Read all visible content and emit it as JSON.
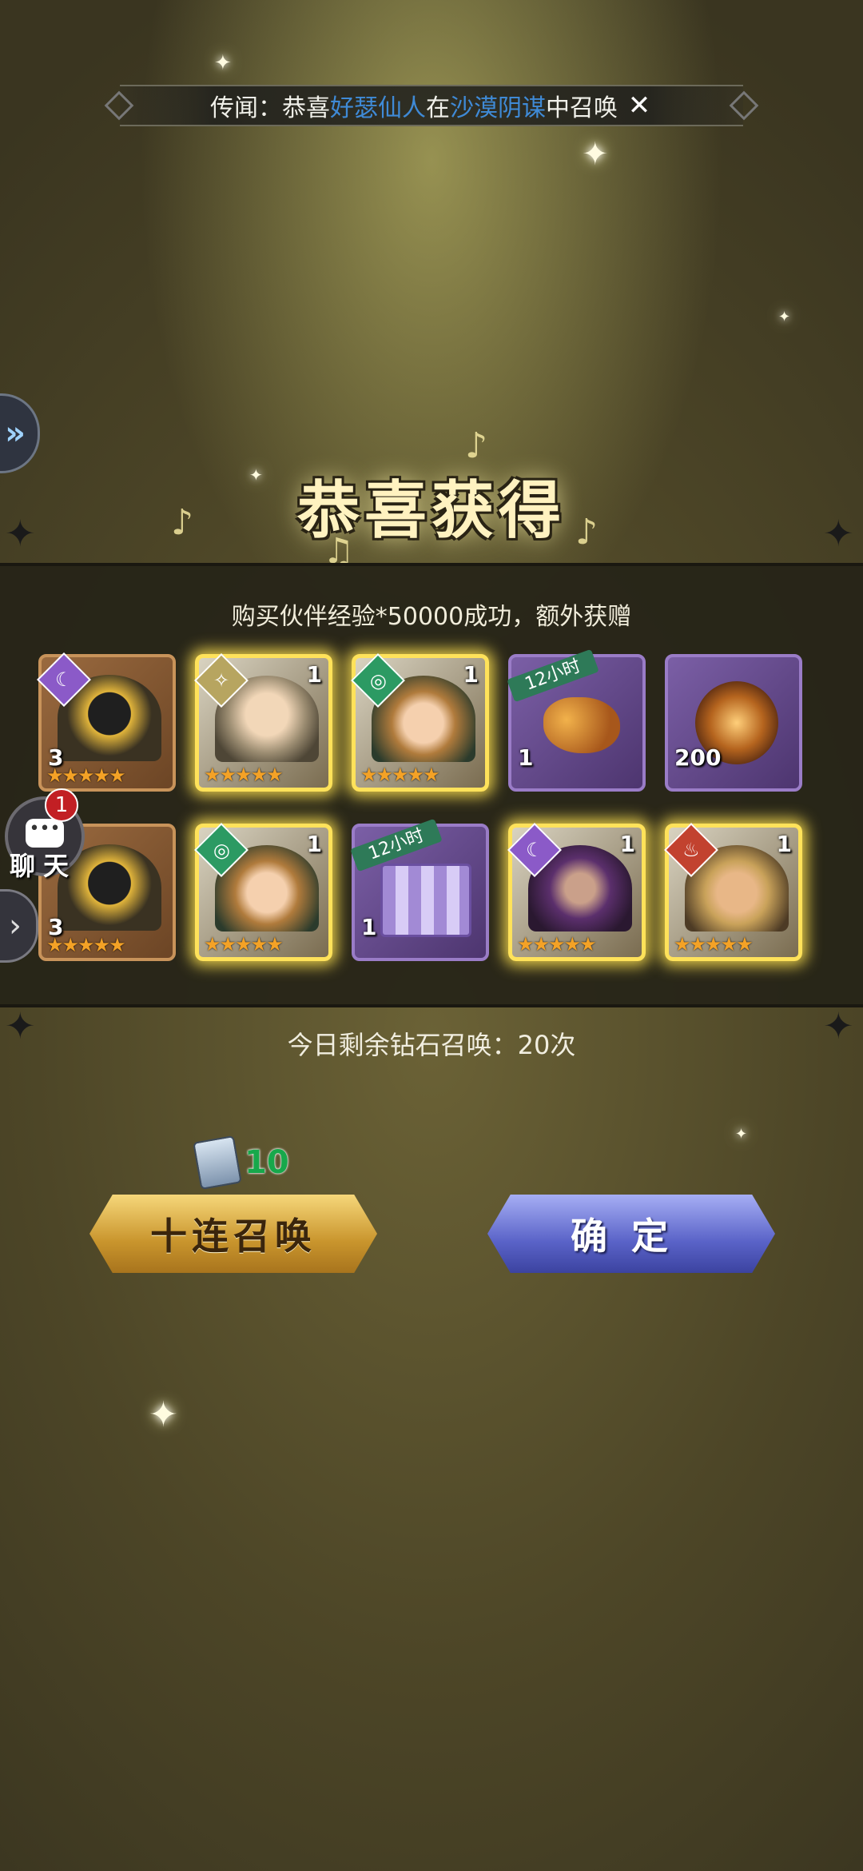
{
  "rumor": {
    "prefix": "传闻：恭喜",
    "player": "好瑟仙人",
    "in": "在",
    "event": "沙漠阴谋",
    "suffix": "中召唤",
    "close_icon": "close-icon"
  },
  "title": "恭喜获得",
  "subtitle": "购买伙伴经验*50000成功，额外获赠",
  "items": [
    {
      "kind": "hero",
      "frame": "bronze",
      "element": "dark",
      "count": "3",
      "level": "",
      "stars": "★★★★★"
    },
    {
      "kind": "hero",
      "frame": "gold",
      "element": "light",
      "count": "",
      "level": "1",
      "stars": "★★★★★"
    },
    {
      "kind": "hero",
      "frame": "gold",
      "element": "wind",
      "count": "",
      "level": "1",
      "stars": "★★★★★"
    },
    {
      "kind": "item",
      "frame": "purple",
      "ribbon": "12小时",
      "count": "1",
      "icon": "gold-ore-icon"
    },
    {
      "kind": "item",
      "frame": "purple",
      "ribbon": "",
      "count": "200",
      "icon": "orb-icon"
    },
    {
      "kind": "hero",
      "frame": "bronze",
      "element": "dark",
      "count": "3",
      "level": "",
      "stars": "★★★★★"
    },
    {
      "kind": "hero",
      "frame": "gold",
      "element": "wind",
      "count": "",
      "level": "1",
      "stars": "★★★★★"
    },
    {
      "kind": "item",
      "frame": "purple",
      "ribbon": "12小时",
      "count": "1",
      "icon": "exp-gift-box-icon"
    },
    {
      "kind": "hero",
      "frame": "gold",
      "element": "dark",
      "count": "",
      "level": "1",
      "stars": "★★★★★"
    },
    {
      "kind": "hero",
      "frame": "gold",
      "element": "fire",
      "count": "",
      "level": "1",
      "stars": "★★★★★"
    }
  ],
  "chat": {
    "label": "聊天",
    "badge": "1"
  },
  "remaining": "今日剩余钻石召唤：20次",
  "cost": {
    "amount": "10",
    "icon": "summon-scroll-icon"
  },
  "buttons": {
    "ten_summon": "十连召唤",
    "confirm": "确定"
  },
  "colors": {
    "highlight": "#3f8ad6",
    "gold_frame": "#ffe25a",
    "cost_green": "#17a84b"
  }
}
